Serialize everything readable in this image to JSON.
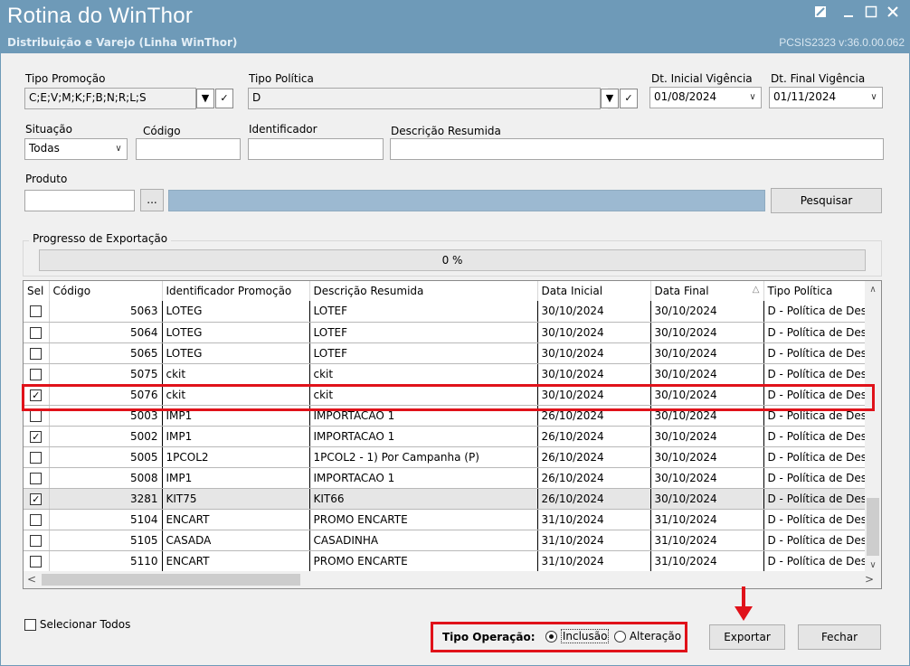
{
  "window": {
    "title": "Rotina do WinThor",
    "subtitle": "Distribuição e Varejo (Linha WinThor)",
    "version": "PCSIS2323  v:36.0.00.062",
    "controls": [
      "pin-icon",
      "minimize-icon",
      "maximize-icon",
      "close-icon"
    ]
  },
  "filters": {
    "tipo_promocao_label": "Tipo Promoção",
    "tipo_promocao_value": "C;E;V;M;K;F;B;N;R;L;S",
    "tipo_politica_label": "Tipo Política",
    "tipo_politica_value": "D",
    "dt_inicial_label": "Dt. Inicial Vigência",
    "dt_inicial_value": "01/08/2024",
    "dt_final_label": "Dt. Final Vigência",
    "dt_final_value": "01/11/2024",
    "situacao_label": "Situação",
    "situacao_value": "Todas",
    "codigo_label": "Código",
    "codigo_value": "",
    "identificador_label": "Identificador",
    "identificador_value": "",
    "descricao_label": "Descrição Resumida",
    "descricao_value": "",
    "produto_label": "Produto",
    "produto_value": "",
    "produto_browse": "...",
    "pesquisar_label": "Pesquisar"
  },
  "progress": {
    "label": "Progresso de Exportação",
    "text": "0 %",
    "value": 0
  },
  "grid": {
    "columns": [
      "Sel",
      "Código",
      "Identificador Promoção",
      "Descrição Resumida",
      "Data Inicial",
      "Data Final",
      "Tipo Política"
    ],
    "sort_indicator": "△",
    "rows": [
      {
        "sel": false,
        "codigo": "5063",
        "ident": "LOTEG",
        "desc": "LOTEF",
        "dtini": "30/10/2024",
        "dtfim": "30/10/2024",
        "tipo": "D - Política de Desc"
      },
      {
        "sel": false,
        "codigo": "5064",
        "ident": "LOTEG",
        "desc": "LOTEF",
        "dtini": "30/10/2024",
        "dtfim": "30/10/2024",
        "tipo": "D - Política de Desc"
      },
      {
        "sel": false,
        "codigo": "5065",
        "ident": "LOTEG",
        "desc": "LOTEF",
        "dtini": "30/10/2024",
        "dtfim": "30/10/2024",
        "tipo": "D - Política de Desc"
      },
      {
        "sel": false,
        "codigo": "5075",
        "ident": "ckit",
        "desc": "ckit",
        "dtini": "30/10/2024",
        "dtfim": "30/10/2024",
        "tipo": "D - Política de Desc"
      },
      {
        "sel": true,
        "codigo": "5076",
        "ident": "ckit",
        "desc": "ckit",
        "dtini": "30/10/2024",
        "dtfim": "30/10/2024",
        "tipo": "D - Política de Desc"
      },
      {
        "sel": false,
        "codigo": "5003",
        "ident": "IMP1",
        "desc": "IMPORTACAO 1",
        "dtini": "26/10/2024",
        "dtfim": "30/10/2024",
        "tipo": "D - Política de Desc"
      },
      {
        "sel": true,
        "codigo": "5002",
        "ident": "IMP1",
        "desc": "IMPORTACAO 1",
        "dtini": "26/10/2024",
        "dtfim": "30/10/2024",
        "tipo": "D - Política de Desc"
      },
      {
        "sel": false,
        "codigo": "5005",
        "ident": "1PCOL2",
        "desc": "1PCOL2 - 1) Por Campanha (P)",
        "dtini": "26/10/2024",
        "dtfim": "30/10/2024",
        "tipo": "D - Política de Desc"
      },
      {
        "sel": false,
        "codigo": "5008",
        "ident": "IMP1",
        "desc": "IMPORTACAO 1",
        "dtini": "26/10/2024",
        "dtfim": "30/10/2024",
        "tipo": "D - Política de Desc"
      },
      {
        "sel": true,
        "codigo": "3281",
        "ident": "KIT75",
        "desc": "KIT66",
        "dtini": "26/10/2024",
        "dtfim": "30/10/2024",
        "tipo": "D - Política de Desc"
      },
      {
        "sel": false,
        "codigo": "5104",
        "ident": "ENCART",
        "desc": "PROMO ENCARTE",
        "dtini": "31/10/2024",
        "dtfim": "31/10/2024",
        "tipo": "D - Política de Desc"
      },
      {
        "sel": false,
        "codigo": "5105",
        "ident": "CASADA",
        "desc": "CASADINHA",
        "dtini": "31/10/2024",
        "dtfim": "31/10/2024",
        "tipo": "D - Política de Desc"
      },
      {
        "sel": false,
        "codigo": "5110",
        "ident": "ENCART",
        "desc": "PROMO ENCARTE",
        "dtini": "31/10/2024",
        "dtfim": "31/10/2024",
        "tipo": "D - Política de Desc"
      }
    ]
  },
  "footer": {
    "selecionar_todos": "Selecionar Todos",
    "tipo_operacao_label": "Tipo Operação:",
    "inclusao_label": "Inclusão",
    "alteracao_label": "Alteração",
    "selected_operation": "Inclusão",
    "exportar_label": "Exportar",
    "fechar_label": "Fechar"
  },
  "colors": {
    "titlebar": "#6e9ab8",
    "highlight": "#e0121a",
    "progress_bar": "#9cb9d1"
  }
}
